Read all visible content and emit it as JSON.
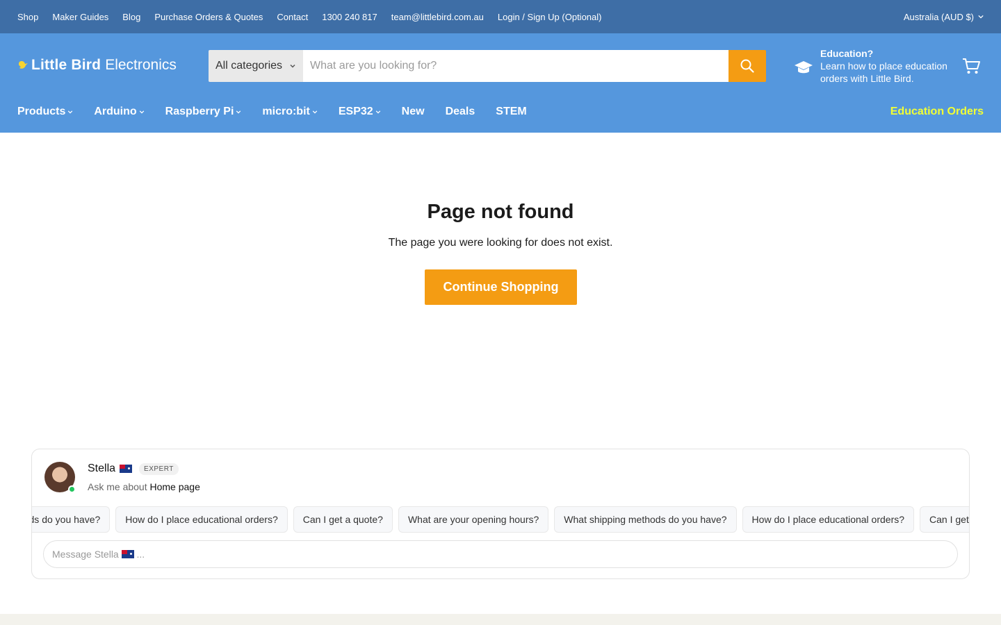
{
  "topbar": {
    "links": [
      "Shop",
      "Maker Guides",
      "Blog",
      "Purchase Orders & Quotes",
      "Contact",
      "1300 240 817",
      "team@littlebird.com.au",
      "Login / Sign Up (Optional)"
    ],
    "currency": "Australia (AUD $)"
  },
  "header": {
    "brand_bold": "Little Bird",
    "brand_light": "Electronics",
    "search": {
      "category": "All categories",
      "placeholder": "What are you looking for?"
    },
    "education": {
      "title": "Education?",
      "text": "Learn how to place education orders with Little Bird."
    }
  },
  "nav": {
    "items": [
      {
        "label": "Products",
        "dropdown": true
      },
      {
        "label": "Arduino",
        "dropdown": true
      },
      {
        "label": "Raspberry Pi",
        "dropdown": true
      },
      {
        "label": "micro:bit",
        "dropdown": true
      },
      {
        "label": "ESP32",
        "dropdown": true
      },
      {
        "label": "New",
        "dropdown": false
      },
      {
        "label": "Deals",
        "dropdown": false
      },
      {
        "label": "STEM",
        "dropdown": false
      }
    ],
    "right_link": "Education Orders"
  },
  "main": {
    "title": "Page not found",
    "message": "The page you were looking for does not exist.",
    "cta": "Continue Shopping"
  },
  "chat": {
    "agent_name": "Stella",
    "badge": "EXPERT",
    "ask_prefix": "Ask me about",
    "ask_topic": "Home page",
    "chips": [
      "What shipping methods do you have?",
      "How do I place educational orders?",
      "Can I get a quote?",
      "What are your opening hours?",
      "What shipping methods do you have?",
      "How do I place educational orders?",
      "Can I get a quote?"
    ],
    "input_placeholder": "Message Stella",
    "input_suffix": "..."
  },
  "colors": {
    "topbar": "#3e6ea6",
    "header": "#5597dd",
    "accent": "#f49c13",
    "education_link": "#f2ff34"
  }
}
